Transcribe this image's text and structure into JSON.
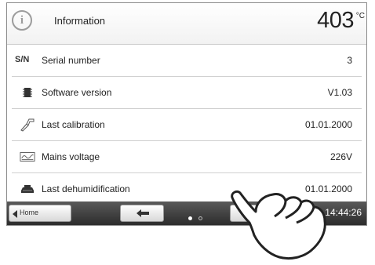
{
  "header": {
    "title": "Information",
    "temperature": "403",
    "temperature_unit": "°C",
    "icon": "info-icon"
  },
  "rows": [
    {
      "icon": "sn-text-icon",
      "label": "Serial number",
      "value": "3",
      "prefix": "S/N"
    },
    {
      "icon": "chip-icon",
      "label": "Software version",
      "value": "V1.03"
    },
    {
      "icon": "calibration-probe-icon",
      "label": "Last calibration",
      "value": "01.01.2000"
    },
    {
      "icon": "voltage-icon",
      "label": "Mains voltage",
      "value": "226V"
    },
    {
      "icon": "dehumidification-icon",
      "label": "Last dehumidification",
      "value": "01.01.2000"
    }
  ],
  "footer": {
    "home_label": "Home",
    "clock": "14:44:26",
    "page_indicator": {
      "current": 1,
      "total": 2
    }
  }
}
